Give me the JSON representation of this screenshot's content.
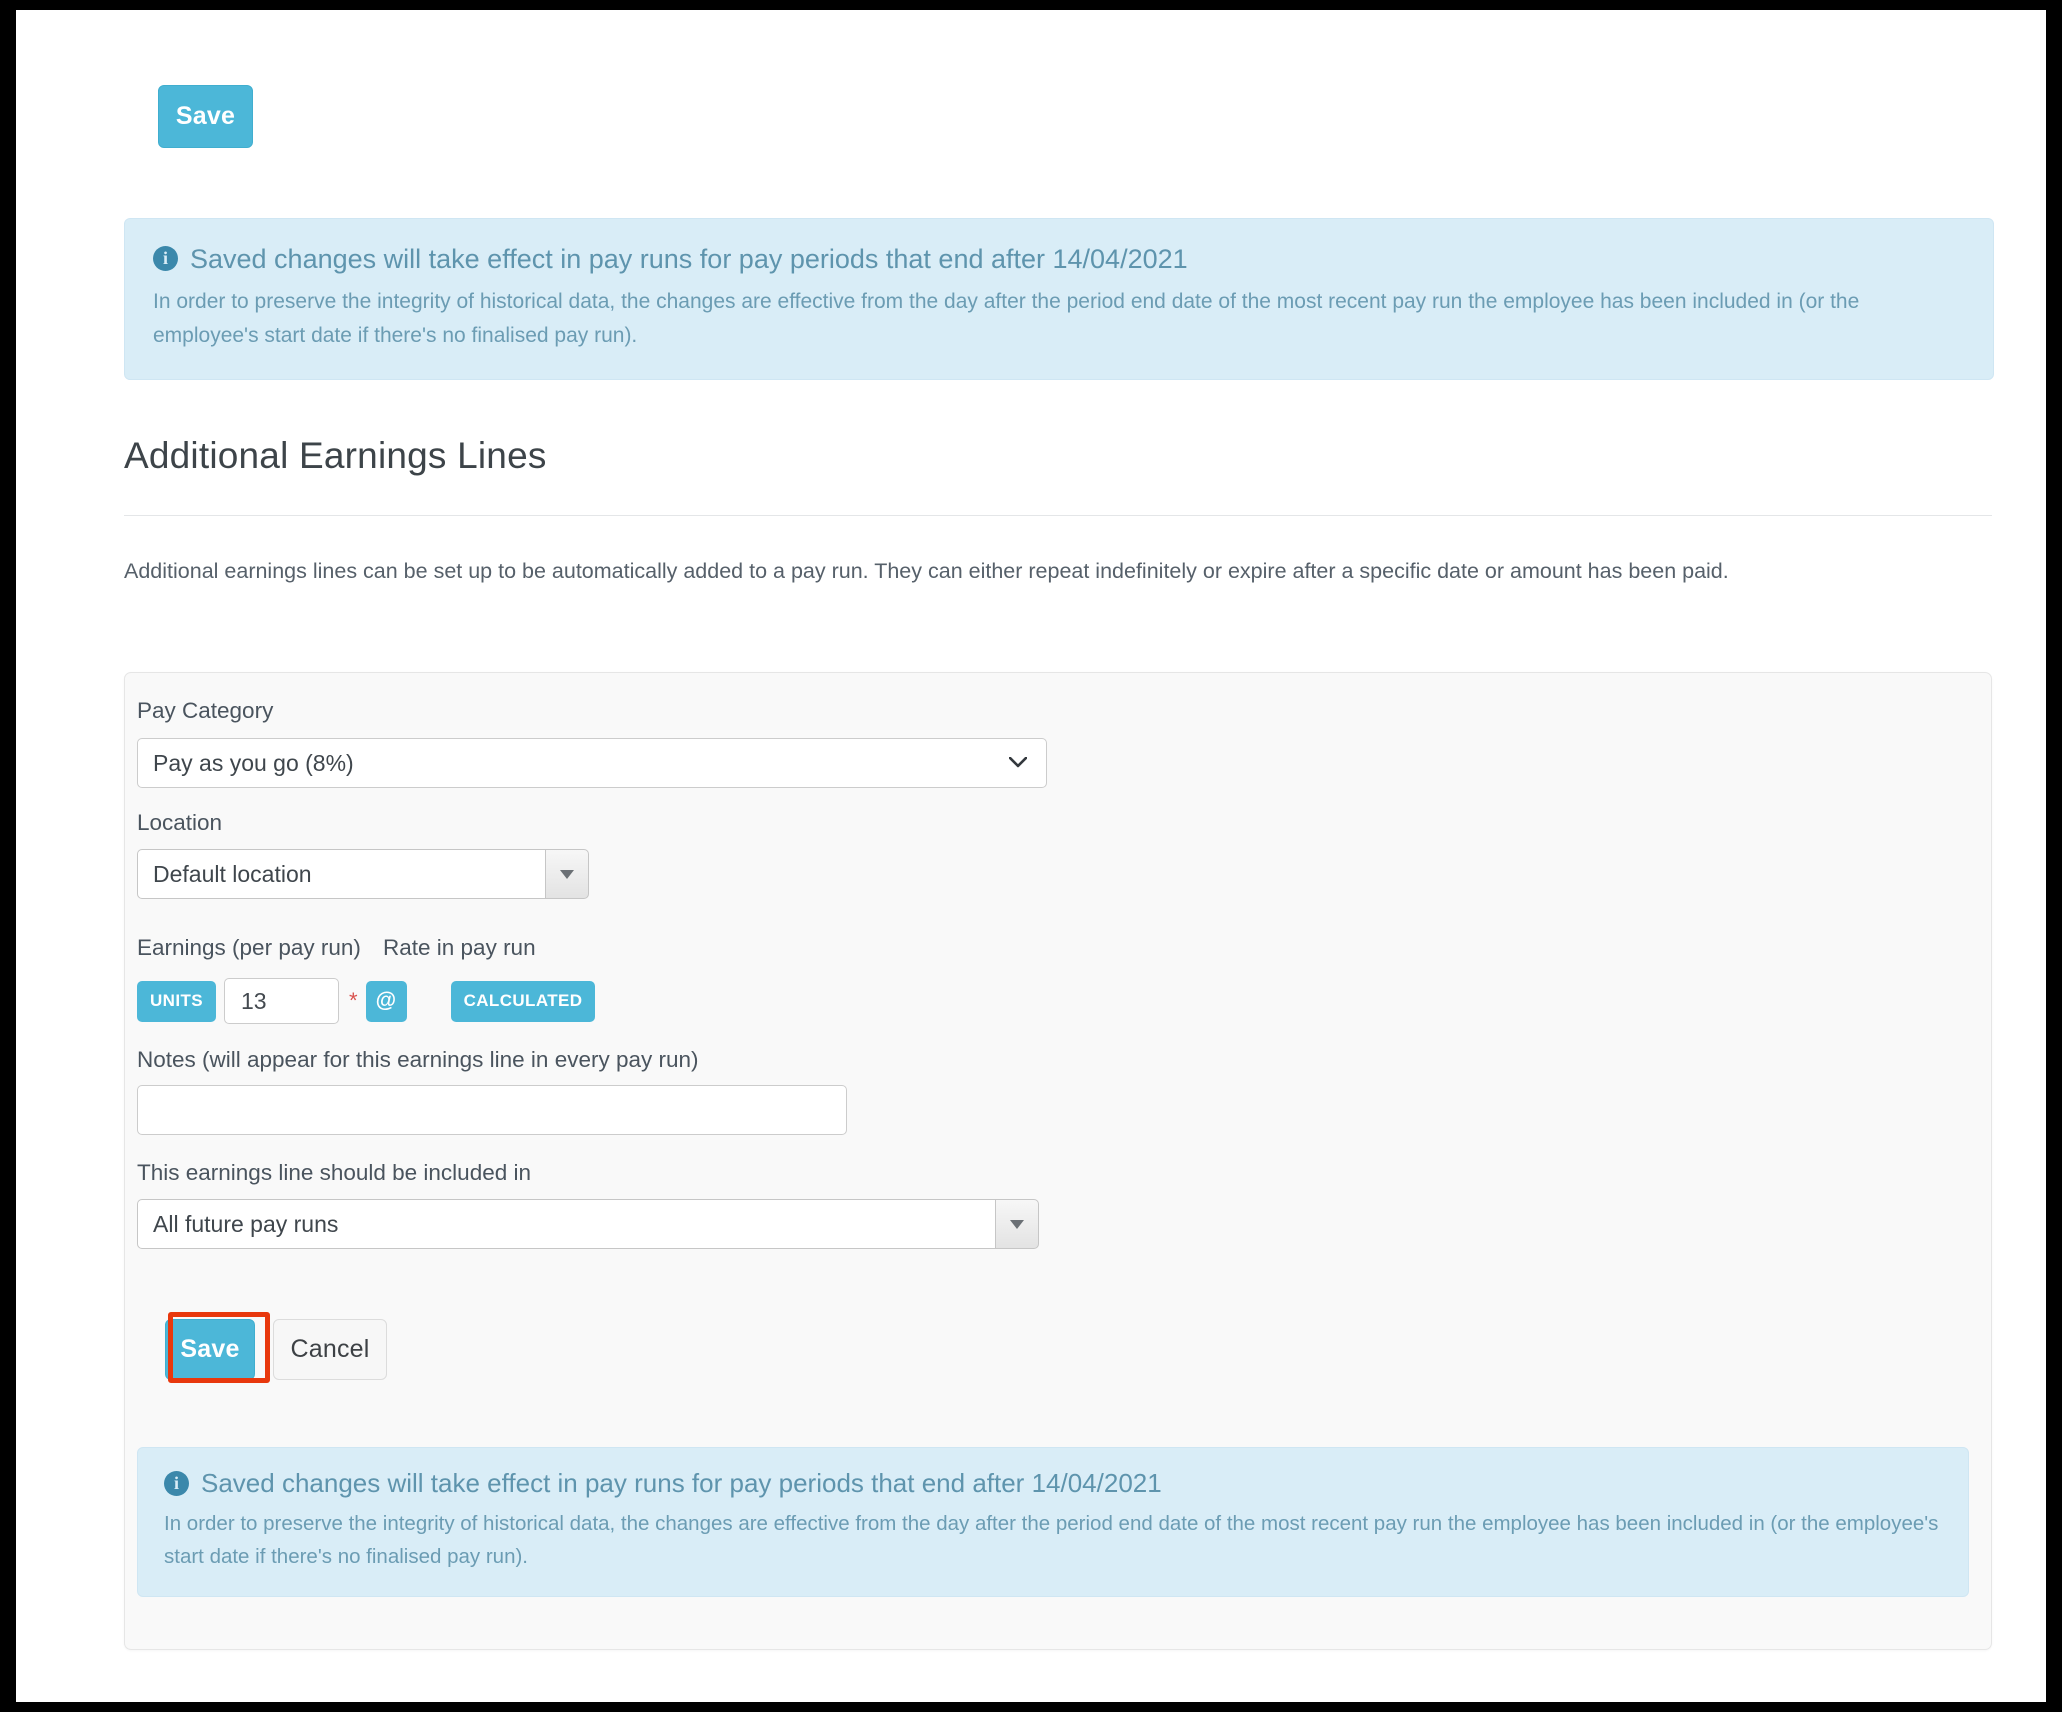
{
  "toolbar": {
    "save_label": "Save"
  },
  "banner": {
    "icon": "info-circle-icon",
    "title": "Saved changes will take effect in pay runs for pay periods that end after 14/04/2021",
    "body": "In order to preserve the integrity of historical data, the changes are effective from the day after the period end date of the most recent pay run the employee has been included in (or the employee's start date if there's no finalised pay run)."
  },
  "section": {
    "heading": "Additional Earnings Lines",
    "description": "Additional earnings lines can be set up to be automatically added to a pay run. They can either repeat indefinitely or expire after a specific date or amount has been paid."
  },
  "form": {
    "pay_category": {
      "label": "Pay Category",
      "value": "Pay as you go (8%)",
      "options": [
        "Pay as you go (8%)"
      ]
    },
    "location": {
      "label": "Location",
      "value": "Default location",
      "options": [
        "Default location"
      ]
    },
    "earnings": {
      "label": "Earnings (per pay run)",
      "units_badge": "UNITS",
      "units_value": "13",
      "required_marker": "*",
      "at_badge": "@"
    },
    "rate": {
      "label": "Rate in pay run",
      "badge": "CALCULATED"
    },
    "notes": {
      "label": "Notes (will appear for this earnings line in every pay run)",
      "value": "",
      "placeholder": ""
    },
    "included_in": {
      "label": "This earnings line should be included in",
      "value": "All future pay runs",
      "options": [
        "All future pay runs"
      ]
    },
    "actions": {
      "save_label": "Save",
      "cancel_label": "Cancel"
    }
  },
  "colors": {
    "accent_teal": "#4cb7d8",
    "info_bg": "#d9edf7",
    "info_text": "#5e94ad",
    "highlight_red": "#e8380d",
    "panel_bg": "#f9f9f9"
  }
}
